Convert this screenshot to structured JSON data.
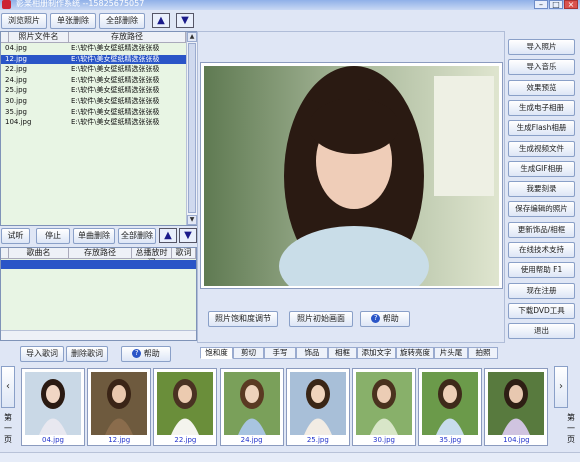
{
  "window": {
    "title": "影楽相册制作系统   --15825675057"
  },
  "top_toolbar": {
    "browse": "浏览照片",
    "delete_one": "单张删除",
    "delete_all": "全部删除"
  },
  "photo_table": {
    "columns": [
      "照片文件名",
      "存放路径"
    ],
    "rows": [
      {
        "name": "04.jpg",
        "path": "E:\\软件\\美女壁纸精选张张极"
      },
      {
        "name": "12.jpg",
        "path": "E:\\软件\\美女壁纸精选张张极",
        "selected": true
      },
      {
        "name": "22.jpg",
        "path": "E:\\软件\\美女壁纸精选张张极"
      },
      {
        "name": "24.jpg",
        "path": "E:\\软件\\美女壁纸精选张张极"
      },
      {
        "name": "25.jpg",
        "path": "E:\\软件\\美女壁纸精选张张极"
      },
      {
        "name": "30.jpg",
        "path": "E:\\软件\\美女壁纸精选张张极"
      },
      {
        "name": "35.jpg",
        "path": "E:\\软件\\美女壁纸精选张张极"
      },
      {
        "name": "104.jpg",
        "path": "E:\\软件\\美女壁纸精选张张极"
      }
    ]
  },
  "music_toolbar": {
    "listen": "试听",
    "stop": "停止",
    "delete_one": "单曲删除",
    "delete_all": "全部删除"
  },
  "music_table": {
    "columns": [
      "歌曲名",
      "存放路径",
      "总播放时间",
      "歌词"
    ]
  },
  "lyrics_toolbar": {
    "import": "导入歌词",
    "delete": "删除歌词",
    "help": "帮助"
  },
  "preview_buttons": {
    "saturation": "照片饱和度调节",
    "crop": "照片初始画面",
    "help": "帮助"
  },
  "right_menu": [
    "导入照片",
    "导入音乐",
    "效果预览",
    "生成电子相册",
    "生成Flash相册",
    "生成视频文件",
    "生成GIF相册",
    "我要刻录",
    "保存编辑的照片",
    "更新饰品/相框",
    "在线技术支持",
    "使用帮助  F1",
    "现在注册",
    "下载DVD工具",
    "退出"
  ],
  "edit_tabs": [
    "饱和度",
    "剪切",
    "手写",
    "饰品",
    "相框",
    "添加文字",
    "旋转亮度",
    "片头尾",
    "拍照"
  ],
  "thumbnails": [
    "04.jpg",
    "12.jpg",
    "22.jpg",
    "24.jpg",
    "25.jpg",
    "30.jpg",
    "35.jpg",
    "104.jpg"
  ],
  "pager": {
    "prev": "第一页",
    "next": "第一页"
  },
  "colors": {
    "accent": "#2a55c7",
    "background": "#dfe6f5",
    "thumb_caption": "#2233cc"
  }
}
